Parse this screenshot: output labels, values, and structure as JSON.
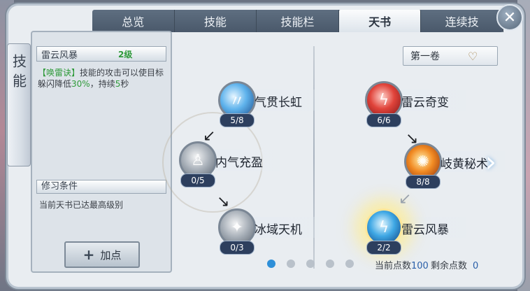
{
  "tabs": [
    {
      "label": "总览",
      "active": false
    },
    {
      "label": "技能",
      "active": false
    },
    {
      "label": "技能栏",
      "active": false
    },
    {
      "label": "天书",
      "active": true
    },
    {
      "label": "连续技",
      "active": false
    }
  ],
  "side_tab": {
    "label": "技能"
  },
  "detail": {
    "skill_name": "雷云风暴",
    "level": "2级",
    "desc_prefix": "【唤雷诀】",
    "desc_body": "技能的攻击可以使目标躲闪降低",
    "desc_value": "30%",
    "desc_mid": "，持续",
    "desc_duration": "5",
    "desc_unit": "秒",
    "requirement_title": "修习条件",
    "requirement_text": "当前天书已达最高级别",
    "add_button": "加点"
  },
  "volume": {
    "label": "第一卷"
  },
  "nodes": [
    {
      "name": "气贯长虹",
      "count": "5/8"
    },
    {
      "name": "内气充盈",
      "count": "0/5"
    },
    {
      "name": "冰域天机",
      "count": "0/3"
    },
    {
      "name": "雷云奇变",
      "count": "6/6"
    },
    {
      "name": "岐黄秘术",
      "count": "8/8"
    },
    {
      "name": "雷云风暴",
      "count": "2/2"
    }
  ],
  "pages": {
    "total": 5,
    "current": 1
  },
  "points": {
    "current_label": "当前点数",
    "current_value": "100",
    "remain_label": "剩余点数",
    "remain_value": "0"
  },
  "colors": {
    "accent_blue": "#2e8fd8",
    "level_green": "#2f9a3a",
    "tab_dark": "#4a596b"
  },
  "icons": [
    "close-icon",
    "plus-icon",
    "next-page-icon",
    "scroll-ornament-icon"
  ]
}
